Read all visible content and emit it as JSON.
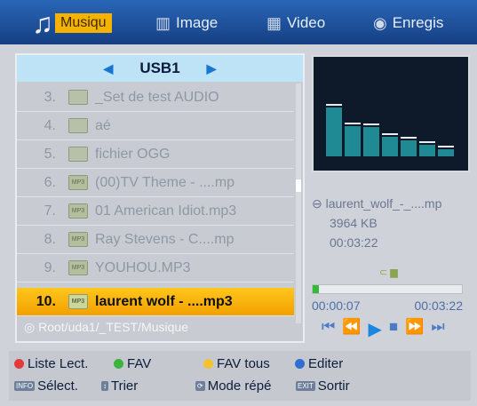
{
  "tabs": [
    {
      "label": "Musiqu",
      "icon": "music-note-icon",
      "active": true
    },
    {
      "label": "Image",
      "icon": "image-icon",
      "active": false
    },
    {
      "label": "Video",
      "icon": "film-icon",
      "active": false
    },
    {
      "label": "Enregis",
      "icon": "record-icon",
      "active": false
    }
  ],
  "source": {
    "label": "USB1"
  },
  "files": [
    {
      "num": "3.",
      "name": "_Set de test AUDIO",
      "type": "folder"
    },
    {
      "num": "4.",
      "name": "aé",
      "type": "folder"
    },
    {
      "num": "5.",
      "name": "fichier OGG",
      "type": "folder"
    },
    {
      "num": "6.",
      "name": "(00)TV Theme - ....mp",
      "type": "mp3"
    },
    {
      "num": "7.",
      "name": "01 American Idiot.mp3",
      "type": "mp3"
    },
    {
      "num": "8.",
      "name": "Ray Stevens - C....mp",
      "type": "mp3"
    },
    {
      "num": "9.",
      "name": "YOUHOU.MP3",
      "type": "mp3"
    },
    {
      "num": "10.",
      "name": "laurent wolf - ....mp3",
      "type": "mp3",
      "selected": true
    }
  ],
  "path": "Root/uda1/_TEST/Musique",
  "visualizer": {
    "levels": [
      0.55,
      0.34,
      0.33,
      0.22,
      0.18,
      0.13,
      0.08
    ]
  },
  "track": {
    "file": "laurent_wolf_-_....mp",
    "size": "3964 KB",
    "duration": "00:03:22",
    "elapsed": "00:00:07",
    "total": "00:03:22",
    "progress": 0.04
  },
  "legend": {
    "red": "Liste Lect.",
    "green": "FAV",
    "yellow": "FAV tous",
    "blue": "Editer",
    "info_key": "INFO",
    "info": "Sélect.",
    "sort": "Trier",
    "mode": "Mode répé",
    "exit_key": "EXIT",
    "exit": "Sortir"
  },
  "colors": {
    "accent": "#f5b300",
    "topbar": "#1f56a8",
    "red": "#e23b3b",
    "green": "#3cb43c",
    "yellow": "#f2c230",
    "blue": "#2f6fd4"
  }
}
